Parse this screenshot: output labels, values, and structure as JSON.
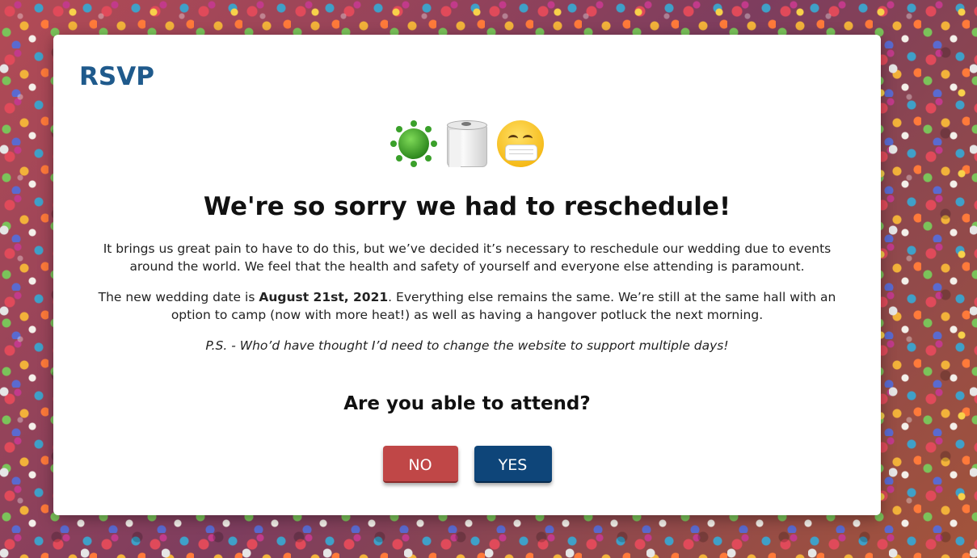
{
  "modal": {
    "title": "RSVP",
    "emojis": [
      "virus-icon",
      "toilet-paper-icon",
      "face-with-mask-icon"
    ],
    "heading": "We're so sorry we had to reschedule!",
    "paragraph1": "It brings us great pain to have to do this, but we’ve decided it’s necessary to reschedule our wedding due to events around the world. We feel that the health and safety of yourself and everyone else attending is paramount.",
    "paragraph2_before": "The new wedding date is ",
    "paragraph2_date": "August 21st, 2021",
    "paragraph2_after": ". Everything else remains the same. We’re still at the same hall with an option to camp (now with more heat!) as well as having a hangover potluck the next morning.",
    "paragraph3": "P.S. - Who’d have thought I’d need to change the website to support multiple days!",
    "question": "Are you able to attend?",
    "buttons": {
      "no_label": "NO",
      "yes_label": "YES"
    }
  },
  "colors": {
    "title": "#1f5a8c",
    "no_button": "#c04747",
    "yes_button": "#0e4579"
  }
}
